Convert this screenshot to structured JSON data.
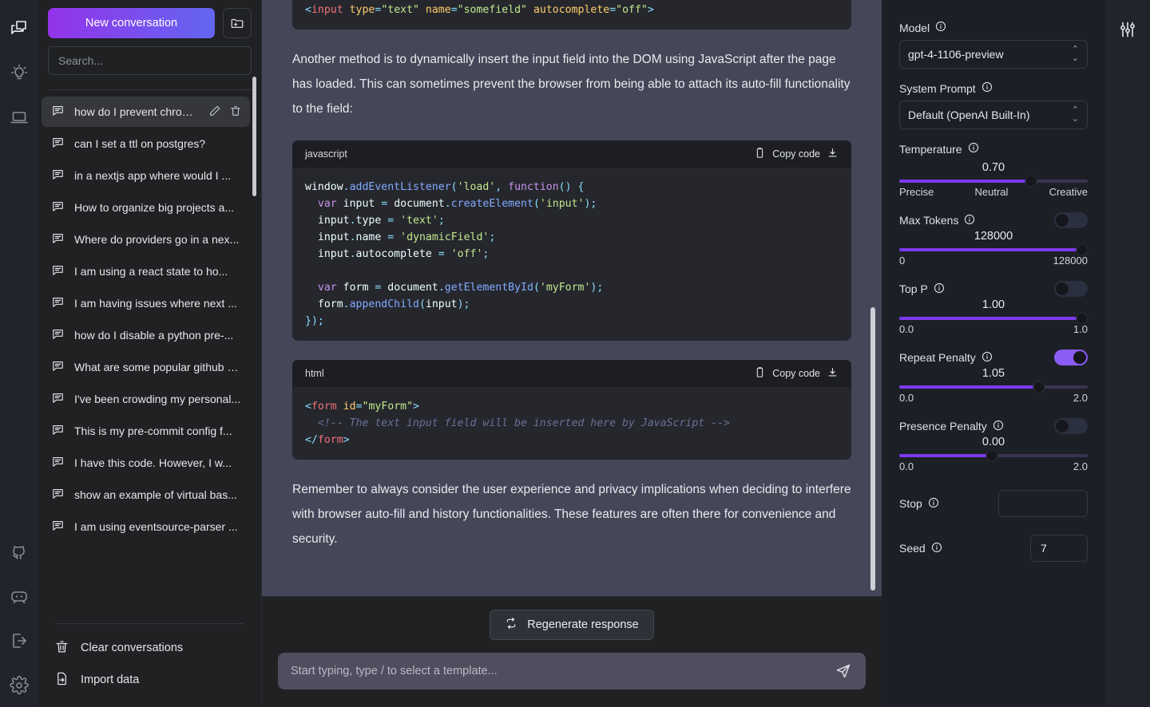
{
  "rail": {
    "top_icons": [
      {
        "name": "chat-bubbles-icon",
        "label": "Chats"
      },
      {
        "name": "lightbulb-icon",
        "label": "Prompts"
      },
      {
        "name": "laptop-icon",
        "label": "Workspace"
      }
    ],
    "bottom_icons": [
      {
        "name": "github-icon",
        "label": "GitHub"
      },
      {
        "name": "discord-icon",
        "label": "Discord"
      },
      {
        "name": "logout-icon",
        "label": "Log out"
      },
      {
        "name": "gear-icon",
        "label": "Settings"
      }
    ]
  },
  "sidebar": {
    "new_conversation_label": "New conversation",
    "new_folder_icon": "folder-plus-icon",
    "search": {
      "placeholder": "Search...",
      "value": ""
    },
    "conversations": [
      {
        "title": "how do I prevent chrome ...",
        "active": true
      },
      {
        "title": "can I set a ttl on postgres?",
        "active": false
      },
      {
        "title": "in a nextjs app where would I ...",
        "active": false
      },
      {
        "title": "How to organize big projects a...",
        "active": false
      },
      {
        "title": "Where do providers go in a nex...",
        "active": false
      },
      {
        "title": "I am using a react state to ho...",
        "active": false
      },
      {
        "title": "I am having issues where next ...",
        "active": false
      },
      {
        "title": "how do I disable a python pre-...",
        "active": false
      },
      {
        "title": "What are some popular github a...",
        "active": false
      },
      {
        "title": "I've been crowding my personal...",
        "active": false
      },
      {
        "title": "This is my pre-commit config f...",
        "active": false
      },
      {
        "title": "I have this code. However, I w...",
        "active": false
      },
      {
        "title": "show an example of virtual bas...",
        "active": false
      },
      {
        "title": "I am using eventsource-parser ...",
        "active": false
      }
    ],
    "actions": [
      {
        "label": "Clear conversations",
        "icon": "trash-icon"
      },
      {
        "label": "Import data",
        "icon": "import-icon"
      }
    ]
  },
  "main": {
    "code_block_top": {
      "language": "html",
      "lines": [
        "<input type=\"text\" name=\"somefield\" autocomplete=\"off\">"
      ]
    },
    "paragraph_1": "Another method is to dynamically insert the input field into the DOM using JavaScript after the page has loaded. This can sometimes prevent the browser from being able to attach its auto-fill functionality to the field:",
    "code_block_js": {
      "language": "javascript",
      "copy_label": "Copy code",
      "copy_icon": "clipboard-icon",
      "download_icon": "download-icon",
      "code": "window.addEventListener('load', function() {\n  var input = document.createElement('input');\n  input.type = 'text';\n  input.name = 'dynamicField';\n  input.autocomplete = 'off';\n\n  var form = document.getElementById('myForm');\n  form.appendChild(input);\n});"
    },
    "code_block_html": {
      "language": "html",
      "copy_label": "Copy code",
      "copy_icon": "clipboard-icon",
      "download_icon": "download-icon",
      "code": "<form id=\"myForm\">\n  <!-- The text input field will be inserted here by JavaScript -->\n</form>"
    },
    "paragraph_2": "Remember to always consider the user experience and privacy implications when deciding to interfere with browser auto-fill and history functionalities. These features are often there for convenience and security.",
    "regenerate_label": "Regenerate response",
    "regenerate_icon": "refresh-icon",
    "composer": {
      "placeholder": "Start typing, type / to select a template...",
      "value": "",
      "send_icon": "send-icon"
    }
  },
  "settings": {
    "panel_icon": "sliders-icon",
    "model": {
      "label": "Model",
      "info_icon": "info-icon",
      "value": "gpt-4-1106-preview"
    },
    "system_prompt": {
      "label": "System Prompt",
      "info_icon": "info-icon",
      "value": "Default (OpenAI Built-In)"
    },
    "temperature": {
      "label": "Temperature",
      "info_icon": "info-icon",
      "value": "0.70",
      "percent": 70,
      "scale_left": "Precise",
      "scale_mid": "Neutral",
      "scale_right": "Creative"
    },
    "max_tokens": {
      "label": "Max Tokens",
      "info_icon": "info-icon",
      "value": "128000",
      "percent": 97,
      "min": "0",
      "max": "128000",
      "enabled": false
    },
    "top_p": {
      "label": "Top P",
      "info_icon": "info-icon",
      "value": "1.00",
      "percent": 97,
      "min": "0.0",
      "max": "1.0",
      "enabled": false
    },
    "repeat_penalty": {
      "label": "Repeat Penalty",
      "info_icon": "info-icon",
      "value": "1.05",
      "percent": 74,
      "min": "0.0",
      "max": "2.0",
      "enabled": true
    },
    "presence_penalty": {
      "label": "Presence Penalty",
      "info_icon": "info-icon",
      "value": "0.00",
      "percent": 49,
      "min": "0.0",
      "max": "2.0",
      "enabled": false
    },
    "stop": {
      "label": "Stop",
      "info_icon": "info-icon",
      "value": "",
      "placeholder": ""
    },
    "seed": {
      "label": "Seed",
      "info_icon": "info-icon",
      "value": "7"
    }
  },
  "colors": {
    "accent": "#7c3aed",
    "brand_gradient_start": "#9333ea",
    "brand_gradient_end": "#6366f1",
    "chat_background": "#434757",
    "sidebar_background": "#202123",
    "settings_background": "#1c1f26"
  }
}
